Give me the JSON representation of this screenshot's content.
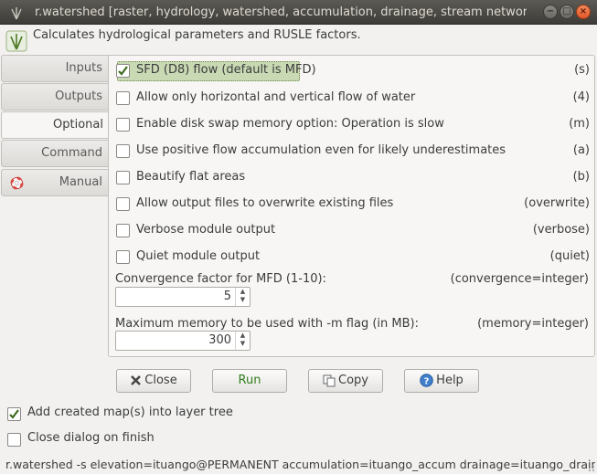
{
  "window": {
    "title": "r.watershed [raster, hydrology, watershed, accumulation, drainage, stream network, strea",
    "min_glyph": "−",
    "max_glyph": "□",
    "close_glyph": "×"
  },
  "description": "Calculates hydrological parameters and RUSLE factors.",
  "tabs": [
    {
      "label": "Inputs"
    },
    {
      "label": "Outputs"
    },
    {
      "label": "Optional"
    },
    {
      "label": "Command output"
    },
    {
      "label": "Manual"
    }
  ],
  "active_tab": "Optional",
  "options": [
    {
      "label": "SFD (D8) flow (default is MFD)",
      "flag": "(s)",
      "checked": true
    },
    {
      "label": "Allow only horizontal and vertical flow of water",
      "flag": "(4)",
      "checked": false
    },
    {
      "label": "Enable disk swap memory option: Operation is slow",
      "flag": "(m)",
      "checked": false
    },
    {
      "label": "Use positive flow accumulation even for likely underestimates",
      "flag": "(a)",
      "checked": false
    },
    {
      "label": "Beautify flat areas",
      "flag": "(b)",
      "checked": false
    },
    {
      "label": "Allow output files to overwrite existing files",
      "flag": "(overwrite)",
      "checked": false
    },
    {
      "label": "Verbose module output",
      "flag": "(verbose)",
      "checked": false
    },
    {
      "label": "Quiet module output",
      "flag": "(quiet)",
      "checked": false
    }
  ],
  "params": {
    "convergence": {
      "label": "Convergence factor for MFD (1-10):",
      "flag": "(convergence=integer)",
      "value": "5"
    },
    "memory": {
      "label": "Maximum memory to be used with -m flag (in MB):",
      "flag": "(memory=integer)",
      "value": "300"
    }
  },
  "buttons": {
    "close": "Close",
    "run": "Run",
    "copy": "Copy",
    "help": "Help"
  },
  "bottom_options": [
    {
      "label": "Add created map(s) into layer tree",
      "checked": true
    },
    {
      "label": "Close dialog on finish",
      "checked": false
    }
  ],
  "command_line": "r.watershed -s elevation=ituango@PERMANENT accumulation=ituango_accum drainage=ituango_drain"
}
